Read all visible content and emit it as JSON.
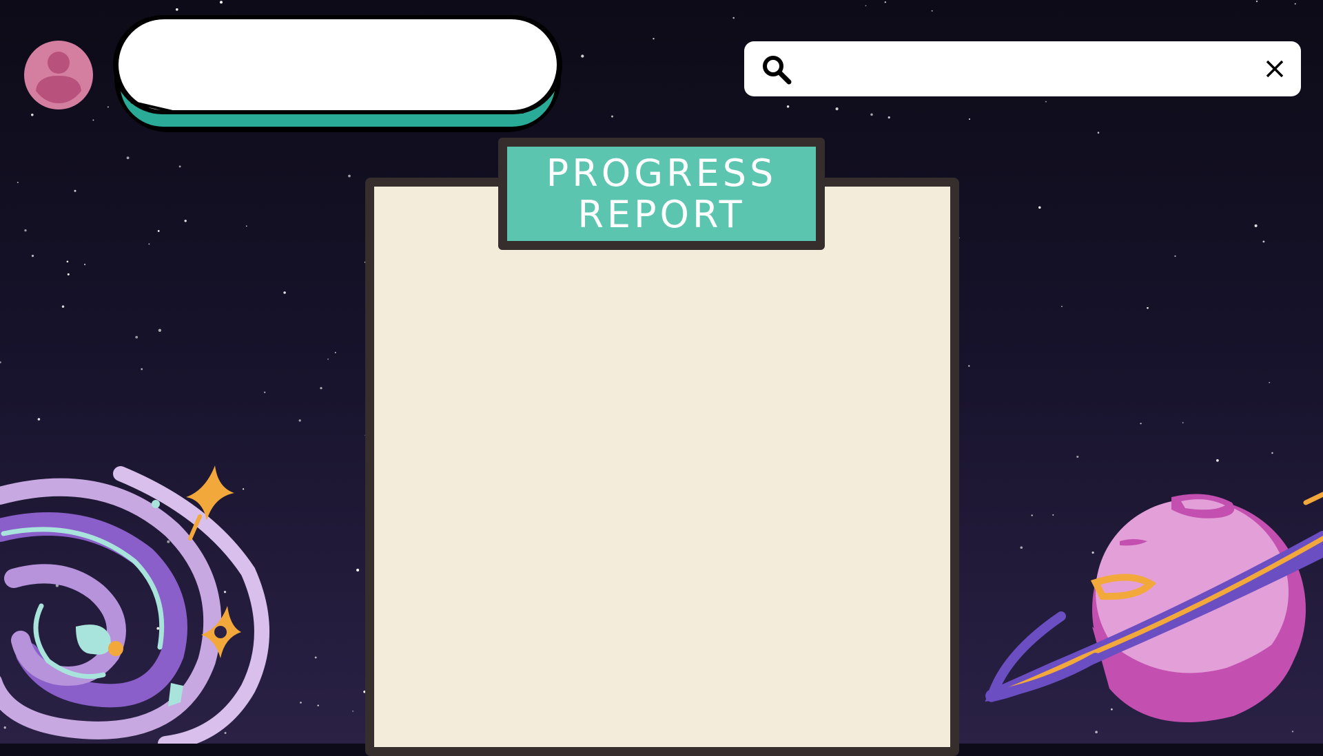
{
  "profile": {
    "name": ""
  },
  "search": {
    "value": "",
    "placeholder": ""
  },
  "report": {
    "title_line1": "PROGRESS",
    "title_line2": "REPORT"
  },
  "colors": {
    "background_top": "#0d0b17",
    "background_bottom": "#2a2145",
    "avatar": "#d47ea0",
    "pill_accent": "#2aab97",
    "label_teal": "#5bc5b0",
    "paper": "#f4ecdb",
    "frame": "#352e2d"
  },
  "icons": [
    "user-avatar-icon",
    "search-icon",
    "close-icon"
  ]
}
